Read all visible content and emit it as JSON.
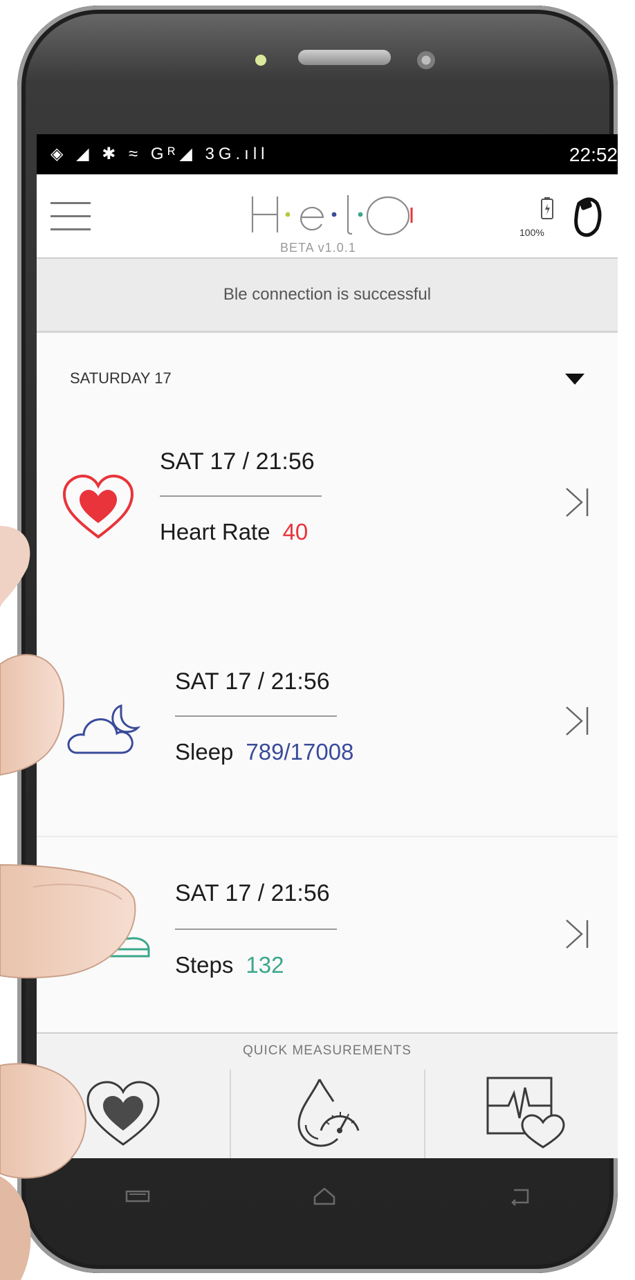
{
  "status_bar": {
    "icons": "◈ ◢ ✱ ≈ Gᴿ◢ 3G.ıll",
    "time": "22:52"
  },
  "app_bar": {
    "logo_text": "H·e·l·O",
    "version": "BETA v1.0.1",
    "battery_percent": "100%"
  },
  "banner": {
    "message": "Ble connection is successful"
  },
  "date_header": {
    "label": "SATURDAY 17"
  },
  "cards": [
    {
      "time": "SAT 17 / 21:56",
      "label": "Heart Rate",
      "value": "40",
      "value_color": "#e8343a",
      "icon": "heart-rate-icon"
    },
    {
      "time": "SAT 17 / 21:56",
      "label": "Sleep",
      "value": "789/17008",
      "value_color": "#3a4b9a",
      "icon": "sleep-moon-cloud-icon"
    },
    {
      "time": "SAT 17 / 21:56",
      "label": "Steps",
      "value": "132",
      "value_color": "#3aa78a",
      "icon": "steps-shoe-icon"
    }
  ],
  "quick_measurements": {
    "title": "QUICK MEASUREMENTS",
    "buttons": [
      "heart-icon",
      "blood-pressure-drop-icon",
      "ecg-heart-icon"
    ]
  },
  "colors": {
    "accent_red": "#e8343a",
    "accent_blue": "#3a4b9a",
    "accent_green": "#3aa78a"
  }
}
